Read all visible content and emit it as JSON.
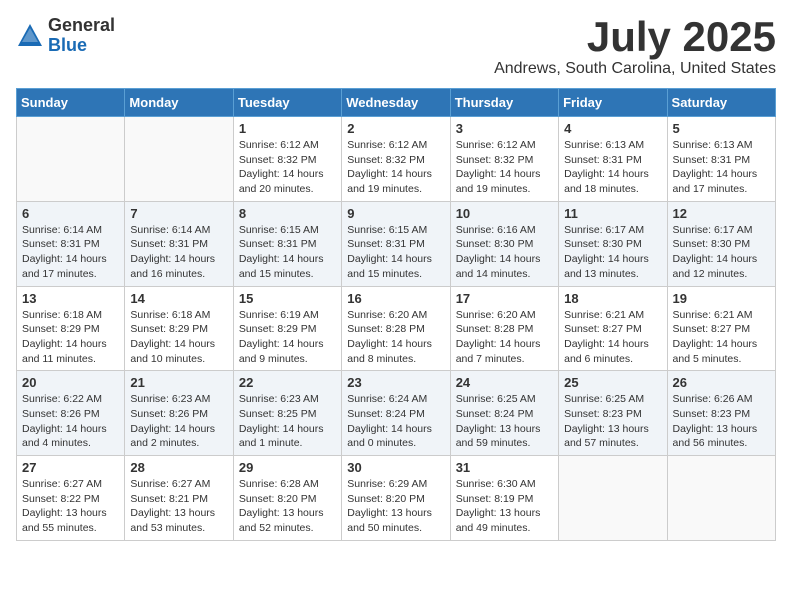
{
  "logo": {
    "general": "General",
    "blue": "Blue"
  },
  "title": "July 2025",
  "location": "Andrews, South Carolina, United States",
  "weekdays": [
    "Sunday",
    "Monday",
    "Tuesday",
    "Wednesday",
    "Thursday",
    "Friday",
    "Saturday"
  ],
  "weeks": [
    [
      {
        "day": "",
        "sunrise": "",
        "sunset": "",
        "daylight": ""
      },
      {
        "day": "",
        "sunrise": "",
        "sunset": "",
        "daylight": ""
      },
      {
        "day": "1",
        "sunrise": "Sunrise: 6:12 AM",
        "sunset": "Sunset: 8:32 PM",
        "daylight": "Daylight: 14 hours and 20 minutes."
      },
      {
        "day": "2",
        "sunrise": "Sunrise: 6:12 AM",
        "sunset": "Sunset: 8:32 PM",
        "daylight": "Daylight: 14 hours and 19 minutes."
      },
      {
        "day": "3",
        "sunrise": "Sunrise: 6:12 AM",
        "sunset": "Sunset: 8:32 PM",
        "daylight": "Daylight: 14 hours and 19 minutes."
      },
      {
        "day": "4",
        "sunrise": "Sunrise: 6:13 AM",
        "sunset": "Sunset: 8:31 PM",
        "daylight": "Daylight: 14 hours and 18 minutes."
      },
      {
        "day": "5",
        "sunrise": "Sunrise: 6:13 AM",
        "sunset": "Sunset: 8:31 PM",
        "daylight": "Daylight: 14 hours and 17 minutes."
      }
    ],
    [
      {
        "day": "6",
        "sunrise": "Sunrise: 6:14 AM",
        "sunset": "Sunset: 8:31 PM",
        "daylight": "Daylight: 14 hours and 17 minutes."
      },
      {
        "day": "7",
        "sunrise": "Sunrise: 6:14 AM",
        "sunset": "Sunset: 8:31 PM",
        "daylight": "Daylight: 14 hours and 16 minutes."
      },
      {
        "day": "8",
        "sunrise": "Sunrise: 6:15 AM",
        "sunset": "Sunset: 8:31 PM",
        "daylight": "Daylight: 14 hours and 15 minutes."
      },
      {
        "day": "9",
        "sunrise": "Sunrise: 6:15 AM",
        "sunset": "Sunset: 8:31 PM",
        "daylight": "Daylight: 14 hours and 15 minutes."
      },
      {
        "day": "10",
        "sunrise": "Sunrise: 6:16 AM",
        "sunset": "Sunset: 8:30 PM",
        "daylight": "Daylight: 14 hours and 14 minutes."
      },
      {
        "day": "11",
        "sunrise": "Sunrise: 6:17 AM",
        "sunset": "Sunset: 8:30 PM",
        "daylight": "Daylight: 14 hours and 13 minutes."
      },
      {
        "day": "12",
        "sunrise": "Sunrise: 6:17 AM",
        "sunset": "Sunset: 8:30 PM",
        "daylight": "Daylight: 14 hours and 12 minutes."
      }
    ],
    [
      {
        "day": "13",
        "sunrise": "Sunrise: 6:18 AM",
        "sunset": "Sunset: 8:29 PM",
        "daylight": "Daylight: 14 hours and 11 minutes."
      },
      {
        "day": "14",
        "sunrise": "Sunrise: 6:18 AM",
        "sunset": "Sunset: 8:29 PM",
        "daylight": "Daylight: 14 hours and 10 minutes."
      },
      {
        "day": "15",
        "sunrise": "Sunrise: 6:19 AM",
        "sunset": "Sunset: 8:29 PM",
        "daylight": "Daylight: 14 hours and 9 minutes."
      },
      {
        "day": "16",
        "sunrise": "Sunrise: 6:20 AM",
        "sunset": "Sunset: 8:28 PM",
        "daylight": "Daylight: 14 hours and 8 minutes."
      },
      {
        "day": "17",
        "sunrise": "Sunrise: 6:20 AM",
        "sunset": "Sunset: 8:28 PM",
        "daylight": "Daylight: 14 hours and 7 minutes."
      },
      {
        "day": "18",
        "sunrise": "Sunrise: 6:21 AM",
        "sunset": "Sunset: 8:27 PM",
        "daylight": "Daylight: 14 hours and 6 minutes."
      },
      {
        "day": "19",
        "sunrise": "Sunrise: 6:21 AM",
        "sunset": "Sunset: 8:27 PM",
        "daylight": "Daylight: 14 hours and 5 minutes."
      }
    ],
    [
      {
        "day": "20",
        "sunrise": "Sunrise: 6:22 AM",
        "sunset": "Sunset: 8:26 PM",
        "daylight": "Daylight: 14 hours and 4 minutes."
      },
      {
        "day": "21",
        "sunrise": "Sunrise: 6:23 AM",
        "sunset": "Sunset: 8:26 PM",
        "daylight": "Daylight: 14 hours and 2 minutes."
      },
      {
        "day": "22",
        "sunrise": "Sunrise: 6:23 AM",
        "sunset": "Sunset: 8:25 PM",
        "daylight": "Daylight: 14 hours and 1 minute."
      },
      {
        "day": "23",
        "sunrise": "Sunrise: 6:24 AM",
        "sunset": "Sunset: 8:24 PM",
        "daylight": "Daylight: 14 hours and 0 minutes."
      },
      {
        "day": "24",
        "sunrise": "Sunrise: 6:25 AM",
        "sunset": "Sunset: 8:24 PM",
        "daylight": "Daylight: 13 hours and 59 minutes."
      },
      {
        "day": "25",
        "sunrise": "Sunrise: 6:25 AM",
        "sunset": "Sunset: 8:23 PM",
        "daylight": "Daylight: 13 hours and 57 minutes."
      },
      {
        "day": "26",
        "sunrise": "Sunrise: 6:26 AM",
        "sunset": "Sunset: 8:23 PM",
        "daylight": "Daylight: 13 hours and 56 minutes."
      }
    ],
    [
      {
        "day": "27",
        "sunrise": "Sunrise: 6:27 AM",
        "sunset": "Sunset: 8:22 PM",
        "daylight": "Daylight: 13 hours and 55 minutes."
      },
      {
        "day": "28",
        "sunrise": "Sunrise: 6:27 AM",
        "sunset": "Sunset: 8:21 PM",
        "daylight": "Daylight: 13 hours and 53 minutes."
      },
      {
        "day": "29",
        "sunrise": "Sunrise: 6:28 AM",
        "sunset": "Sunset: 8:20 PM",
        "daylight": "Daylight: 13 hours and 52 minutes."
      },
      {
        "day": "30",
        "sunrise": "Sunrise: 6:29 AM",
        "sunset": "Sunset: 8:20 PM",
        "daylight": "Daylight: 13 hours and 50 minutes."
      },
      {
        "day": "31",
        "sunrise": "Sunrise: 6:30 AM",
        "sunset": "Sunset: 8:19 PM",
        "daylight": "Daylight: 13 hours and 49 minutes."
      },
      {
        "day": "",
        "sunrise": "",
        "sunset": "",
        "daylight": ""
      },
      {
        "day": "",
        "sunrise": "",
        "sunset": "",
        "daylight": ""
      }
    ]
  ]
}
